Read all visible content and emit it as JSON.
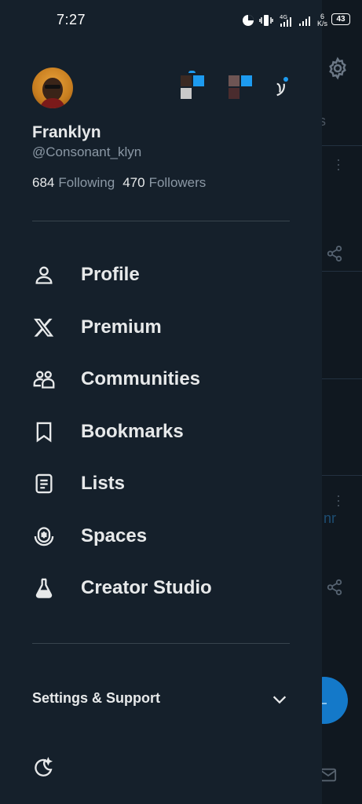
{
  "status": {
    "time": "7:27",
    "battery": "43",
    "net_speed_num": "6",
    "net_speed_unit": "K/s"
  },
  "profile": {
    "name": "Franklyn",
    "handle": "@Consonant_klyn",
    "following_count": "684",
    "following_label": "Following",
    "followers_count": "470",
    "followers_label": "Followers"
  },
  "menu": {
    "items": [
      {
        "label": "Profile",
        "icon": "person-icon"
      },
      {
        "label": "Premium",
        "icon": "x-logo-icon"
      },
      {
        "label": "Communities",
        "icon": "communities-icon"
      },
      {
        "label": "Bookmarks",
        "icon": "bookmark-icon"
      },
      {
        "label": "Lists",
        "icon": "list-icon"
      },
      {
        "label": "Spaces",
        "icon": "spaces-icon"
      },
      {
        "label": "Creator Studio",
        "icon": "flask-icon"
      }
    ]
  },
  "settings": {
    "label": "Settings & Support"
  },
  "background": {
    "tab_fragment": "ns",
    "link_fragment": "nr"
  },
  "colors": {
    "drawer_bg": "#15202b",
    "accent": "#1d9bf0",
    "text": "#e7e9ea",
    "muted": "#8b98a5"
  }
}
